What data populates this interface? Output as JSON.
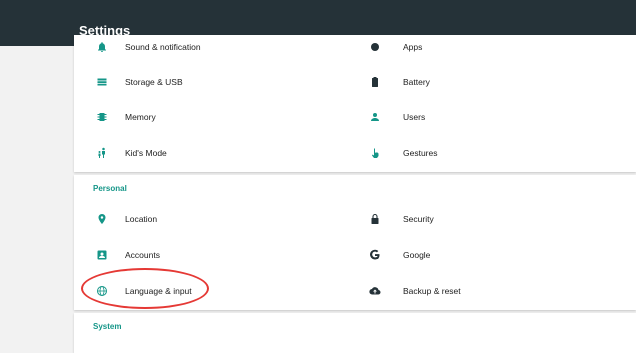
{
  "app_bar": {
    "title": "Settings"
  },
  "device_section": {
    "items_left": [
      {
        "label": "Sound & notification",
        "icon": "bell-icon"
      },
      {
        "label": "Storage & USB",
        "icon": "storage-icon"
      },
      {
        "label": "Memory",
        "icon": "memory-chip-icon"
      },
      {
        "label": "Kid's Mode",
        "icon": "kids-mode-icon"
      }
    ],
    "items_right": [
      {
        "label": "Apps",
        "icon": "apps-icon"
      },
      {
        "label": "Battery",
        "icon": "battery-icon"
      },
      {
        "label": "Users",
        "icon": "user-icon"
      },
      {
        "label": "Gestures",
        "icon": "gesture-hand-icon"
      }
    ]
  },
  "personal_section": {
    "header": "Personal",
    "items_left": [
      {
        "label": "Location",
        "icon": "location-pin-icon"
      },
      {
        "label": "Accounts",
        "icon": "account-box-icon"
      },
      {
        "label": "Language & input",
        "icon": "globe-icon"
      }
    ],
    "items_right": [
      {
        "label": "Security",
        "icon": "lock-icon"
      },
      {
        "label": "Google",
        "icon": "google-g-icon"
      },
      {
        "label": "Backup & reset",
        "icon": "cloud-upload-icon"
      }
    ]
  },
  "system_section": {
    "header": "System"
  },
  "colors": {
    "app_bar": "#253238",
    "accent": "#159688",
    "annotation": "#e53935"
  }
}
